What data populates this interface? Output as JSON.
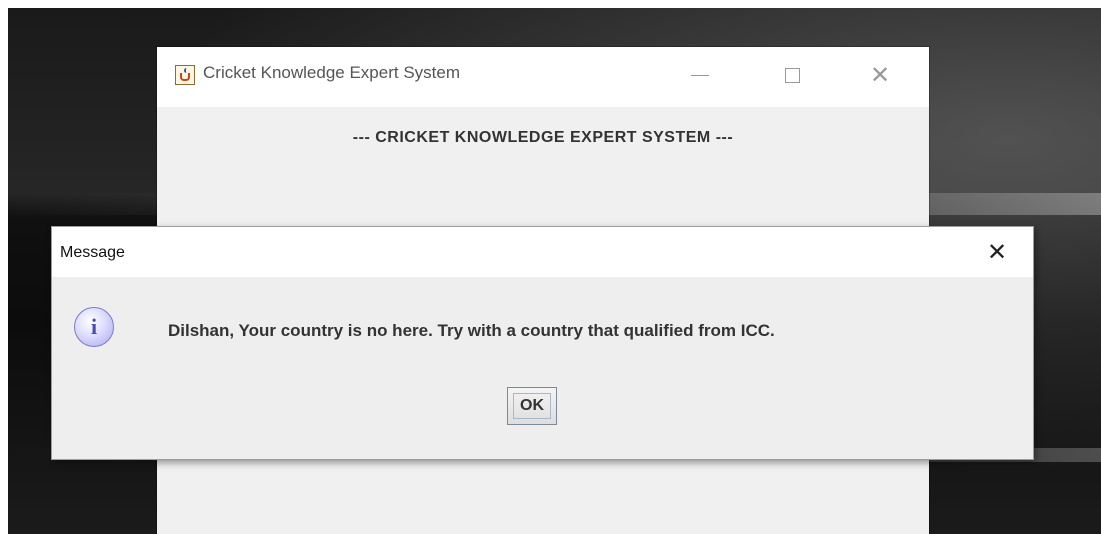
{
  "main_window": {
    "title": "Cricket Knowledge Expert System",
    "header": "--- CRICKET KNOWLEDGE EXPERT SYSTEM ---",
    "minimize_glyph": "",
    "close_glyph": "✕"
  },
  "dialog": {
    "title": "Message",
    "close_glyph": "✕",
    "icon_glyph": "i",
    "message": "Dilshan, Your country is no here. Try with a country that qualified from ICC.",
    "ok_label": "OK"
  },
  "icons": {
    "app": "java-cup-icon",
    "info": "info-icon"
  },
  "colors": {
    "window_bg": "#f0f0f0",
    "titlebar_bg": "#ffffff",
    "info_icon": "#a8a8e8"
  }
}
